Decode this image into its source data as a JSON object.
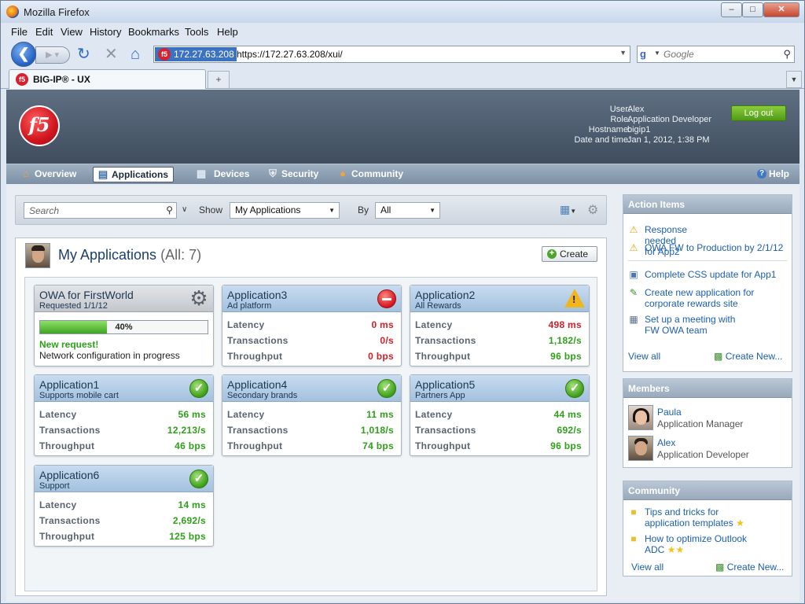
{
  "browser": {
    "window_title": "Mozilla Firefox",
    "menu": [
      "File",
      "Edit",
      "View",
      "History",
      "Bookmarks",
      "Tools",
      "Help"
    ],
    "site_identity": "172.27.63.208",
    "url": "https://172.27.63.208/xui/",
    "search_placeholder": "Google",
    "tab_title": "BIG-IP® - UX",
    "new_tab_symbol": "+"
  },
  "header": {
    "logo_text": "f5",
    "user_label": "User:",
    "user_value": "Alex",
    "role_label": "Role:",
    "role_value": "Application Developer",
    "hostname_label": "Hostname:",
    "hostname_value": "bigip1",
    "datetime_label": "Date and time:",
    "datetime_value": "Jan 1, 2012, 1:38 PM",
    "logout_label": "Log out"
  },
  "nav": {
    "items": [
      {
        "label": "Overview",
        "icon": "home-icon"
      },
      {
        "label": "Applications",
        "icon": "applications-icon",
        "active": true
      },
      {
        "label": "Devices",
        "icon": "devices-icon"
      },
      {
        "label": "Security",
        "icon": "shield-icon"
      },
      {
        "label": "Community",
        "icon": "community-icon"
      }
    ],
    "help_label": "Help"
  },
  "toolbar": {
    "search_placeholder": "Search",
    "show_label": "Show",
    "show_value": "My Applications",
    "by_label": "By",
    "by_value": "All"
  },
  "apps": {
    "title": "My Applications",
    "count": "(All: 7)",
    "create_label": "Create",
    "metric_labels": {
      "latency": "Latency",
      "transactions": "Transactions",
      "throughput": "Throughput"
    },
    "pending": {
      "name": "OWA for FirstWorld",
      "subtitle": "Requested 1/1/12",
      "progress": 0.4,
      "progress_text": "40%",
      "status_line": "New request!",
      "detail_line": "Network configuration in progress"
    },
    "cards": [
      {
        "name": "Application3",
        "subtitle": "Ad platform",
        "status": "error",
        "latency": "0 ms",
        "transactions": "0/s",
        "throughput": "0 bps",
        "tone": "red"
      },
      {
        "name": "Application2",
        "subtitle": "All Rewards",
        "status": "warning",
        "latency": "498 ms",
        "transactions": "1,182/s",
        "throughput": "96 bps",
        "tone": "mixed"
      },
      {
        "name": "Application1",
        "subtitle": "Supports mobile cart",
        "status": "ok",
        "latency": "56 ms",
        "transactions": "12,213/s",
        "throughput": "46 bps",
        "tone": "green"
      },
      {
        "name": "Application4",
        "subtitle": "Secondary brands",
        "status": "ok",
        "latency": "11 ms",
        "transactions": "1,018/s",
        "throughput": "74 bps",
        "tone": "green"
      },
      {
        "name": "Application5",
        "subtitle": "Partners App",
        "status": "ok",
        "latency": "44 ms",
        "transactions": "692/s",
        "throughput": "96 bps",
        "tone": "green"
      },
      {
        "name": "Application6",
        "subtitle": "Support",
        "status": "ok",
        "latency": "14 ms",
        "transactions": "2,692/s",
        "throughput": "125 bps",
        "tone": "green"
      }
    ]
  },
  "action_items": {
    "title": "Action Items",
    "items": [
      {
        "text": "Response needed for App2",
        "icon": "warning-icon"
      },
      {
        "text": "OWA FW to Production by 2/1/12",
        "icon": "warning-icon"
      },
      {
        "text": "Complete CSS update for App1",
        "icon": "task-window-icon"
      },
      {
        "text_line1": "Create new application for",
        "text_line2": "corporate rewards site",
        "icon": "edit-icon"
      },
      {
        "text_line1": "Set up a meeting with",
        "text_line2": "FW OWA team",
        "icon": "calendar-icon"
      }
    ],
    "view_all": "View all",
    "create_new": "Create New..."
  },
  "members": {
    "title": "Members",
    "people": [
      {
        "name": "Paula",
        "role": "Application Manager"
      },
      {
        "name": "Alex",
        "role": "Application Developer"
      }
    ]
  },
  "community": {
    "title": "Community",
    "posts": [
      {
        "line1": "Tips and tricks for",
        "line2": "application templates",
        "stars": 1
      },
      {
        "line1": "How to optimize Outlook",
        "line2": "ADC",
        "stars": 2
      }
    ],
    "view_all": "View all",
    "create_new": "Create New..."
  }
}
